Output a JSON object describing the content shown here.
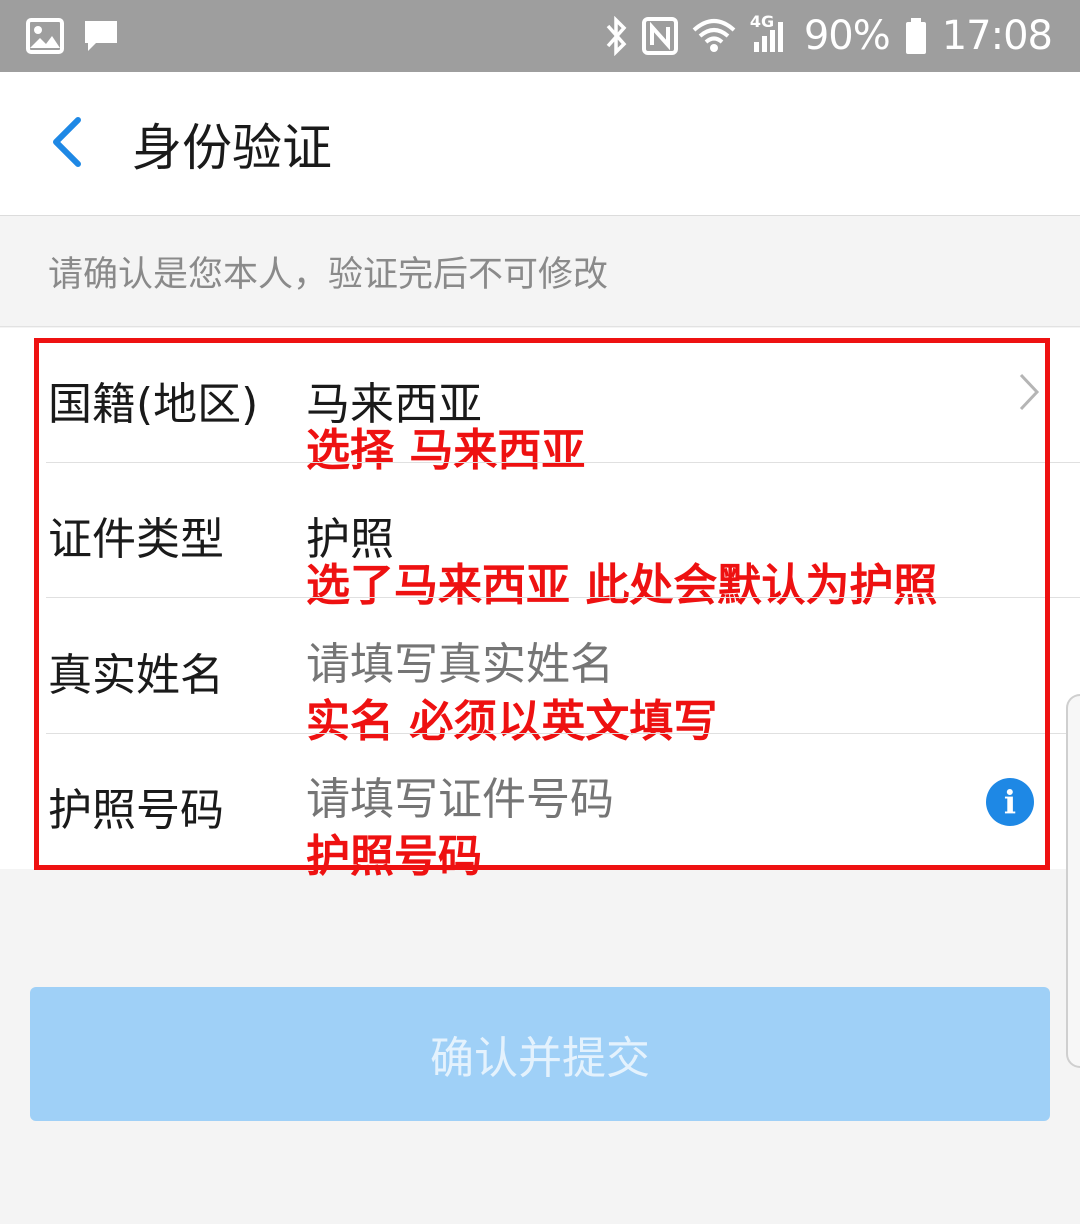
{
  "status_bar": {
    "icons_left": [
      "image-icon",
      "message-icon"
    ],
    "icons_right": [
      "bluetooth-icon",
      "nfc-icon",
      "wifi-icon",
      "signal-4g-icon",
      "battery-icon"
    ],
    "network_label": "4G",
    "battery": "90%",
    "time": "17:08"
  },
  "header": {
    "title": "身份验证"
  },
  "notice": "请确认是您本人，验证完后不可修改",
  "form": {
    "nationality": {
      "label": "国籍(地区)",
      "value": "马来西亚",
      "note": "选择 马来西亚"
    },
    "id_type": {
      "label": "证件类型",
      "value": "护照",
      "note": "选了马来西亚 此处会默认为护照"
    },
    "real_name": {
      "label": "真实姓名",
      "placeholder": "请填写真实姓名",
      "note": "实名 必须以英文填写"
    },
    "passport_no": {
      "label": "护照号码",
      "placeholder": "请填写证件号码",
      "note": "护照号码"
    }
  },
  "submit_label": "确认并提交",
  "colors": {
    "accent": "#1e88e5",
    "annotation": "#ee1111",
    "submit_disabled": "#9fd0f7",
    "status_bar": "#9e9e9e"
  }
}
